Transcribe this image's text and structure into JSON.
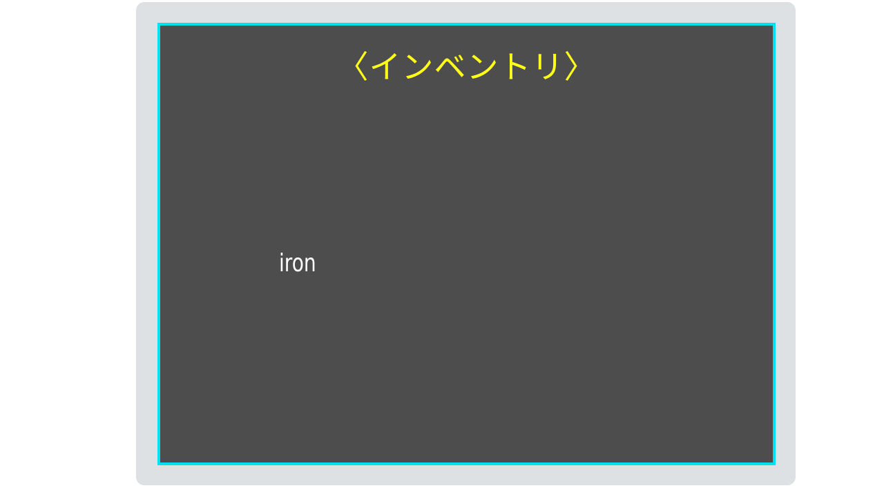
{
  "inventory": {
    "title": "〈インベントリ〉",
    "items": [
      {
        "name": "iron"
      }
    ]
  },
  "colors": {
    "page_background": "#ffffff",
    "frame": "#dde1e3",
    "panel_background": "#4d4d4d",
    "panel_border": "#00e3ee",
    "title": "#ffff1a",
    "item_text": "#ffffff"
  }
}
